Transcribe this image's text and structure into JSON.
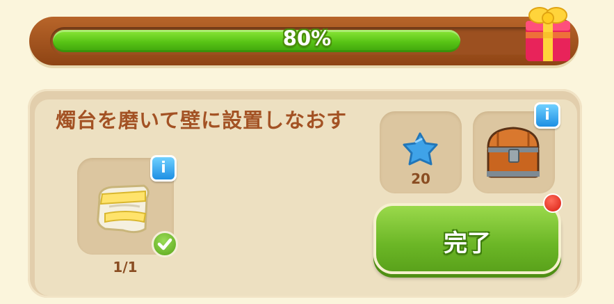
{
  "progress": {
    "label": "80%",
    "value": 0.8,
    "bar_color": "#57c315"
  },
  "task": {
    "title": "燭台を磨いて壁に設置しなおす",
    "required_item": {
      "icon": "cloth-icon",
      "count": "1/1",
      "completed": true
    },
    "rewards": [
      {
        "icon": "blue-star-icon",
        "value": "20"
      },
      {
        "icon": "treasure-chest-icon"
      }
    ]
  },
  "actions": {
    "complete_label": "完了",
    "button_color": "#6bb626"
  },
  "colors": {
    "title_text": "#a35224",
    "info_badge": "#1d8fe3",
    "notify_dot": "#d81f12"
  }
}
